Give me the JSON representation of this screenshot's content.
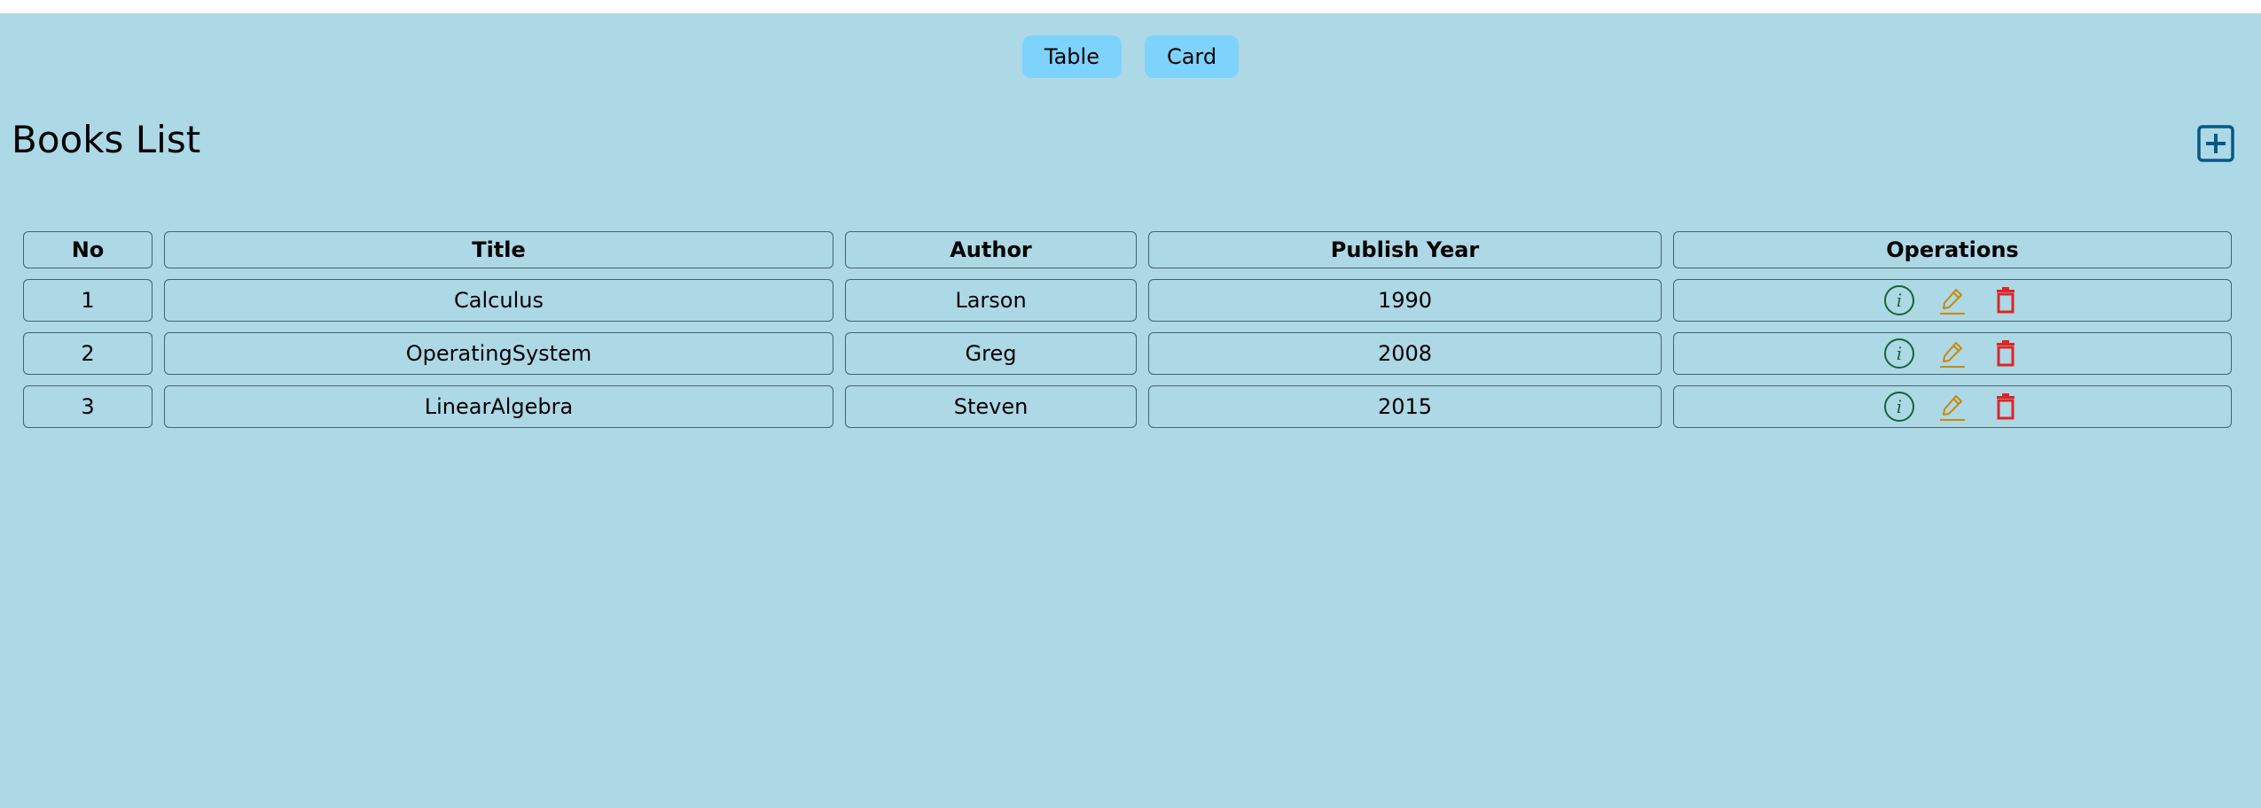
{
  "view_toggle": {
    "table_label": "Table",
    "card_label": "Card"
  },
  "header": {
    "title": "Books List",
    "add_icon": "plus-square-icon"
  },
  "table": {
    "columns": [
      "No",
      "Title",
      "Author",
      "Publish Year",
      "Operations"
    ],
    "rows": [
      {
        "no": "1",
        "title": "Calculus",
        "author": "Larson",
        "year": "1990"
      },
      {
        "no": "2",
        "title": "OperatingSystem",
        "author": "Greg",
        "year": "2008"
      },
      {
        "no": "3",
        "title": "LinearAlgebra",
        "author": "Steven",
        "year": "2015"
      }
    ],
    "operation_icons": [
      "info-circle-icon",
      "edit-pencil-icon",
      "delete-trash-icon"
    ]
  },
  "colors": {
    "page_bg": "#add8e6",
    "toggle_bg": "#7dd3fc",
    "add_icon": "#075985",
    "info_icon": "#166534",
    "edit_icon": "#ca8a04",
    "delete_icon": "#dc2626",
    "cell_border": "#46626b"
  }
}
